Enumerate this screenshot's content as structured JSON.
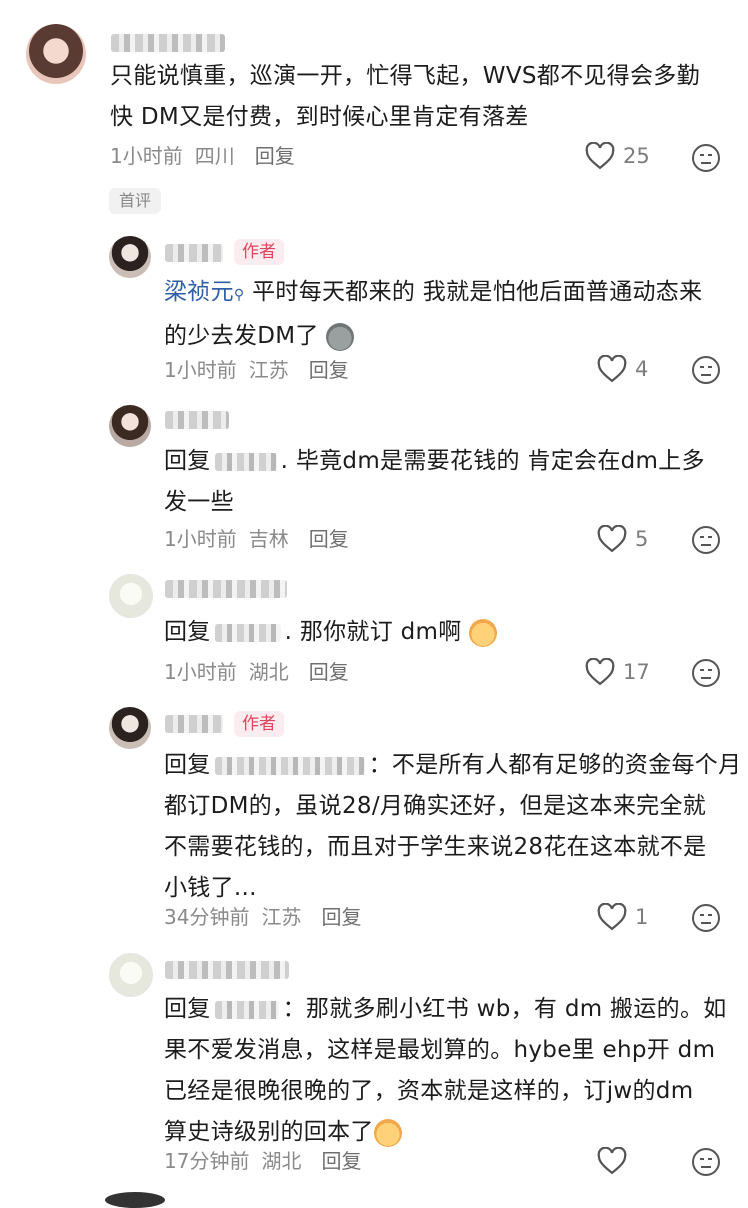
{
  "colors": {
    "author_tag_bg": "#fdecef",
    "author_tag_text": "#e0455f",
    "mention": "#2f5fa8",
    "meta": "#8a8a8a"
  },
  "comments": [
    {
      "text_lines": [
        "只能说慎重，巡演一开，忙得飞起，WVS都不见得会多勤",
        "快 DM又是付费，到时候心里肯定有落差"
      ],
      "time": "1小时前",
      "location": "四川",
      "reply_label": "回复",
      "likes": "25",
      "badge": "首评"
    },
    {
      "author_tag": "作者",
      "mention": "梁祯元",
      "text_line1": "平时每天都来的 我就是怕他后面普通动态来",
      "text_line2": "的少去发DM了",
      "time": "1小时前",
      "location": "江苏",
      "reply_label": "回复",
      "likes": "4"
    },
    {
      "reply_prefix": "回复",
      "text_line1": ". 毕竟dm是需要花钱的 肯定会在dm上多",
      "text_line2": "发一些",
      "time": "1小时前",
      "location": "吉林",
      "reply_label": "回复",
      "likes": "5"
    },
    {
      "reply_prefix": "回复",
      "text_line1": ". 那你就订 dm啊",
      "time": "1小时前",
      "location": "湖北",
      "reply_label": "回复",
      "likes": "17"
    },
    {
      "author_tag": "作者",
      "reply_prefix": "回复",
      "text_line1": "：不是所有人都有足够的资金每个月",
      "text_lines": [
        "都订DM的，虽说28/月确实还好，但是这本来完全就",
        "不需要花钱的，而且对于学生来说28花在这本就不是",
        "小钱了..."
      ],
      "time": "34分钟前",
      "location": "江苏",
      "reply_label": "回复",
      "likes": "1"
    },
    {
      "reply_prefix": "回复",
      "text_line1": "：那就多刷小红书 wb，有 dm 搬运的。如",
      "text_lines": [
        "果不爱发消息，这样是最划算的。hybe里 ehp开 dm",
        "已经是很晚很晚的了，资本就是这样的，订jw的dm",
        "算史诗级别的回本了"
      ],
      "time": "17分钟前",
      "location": "湖北",
      "reply_label": "回复",
      "likes": ""
    }
  ]
}
